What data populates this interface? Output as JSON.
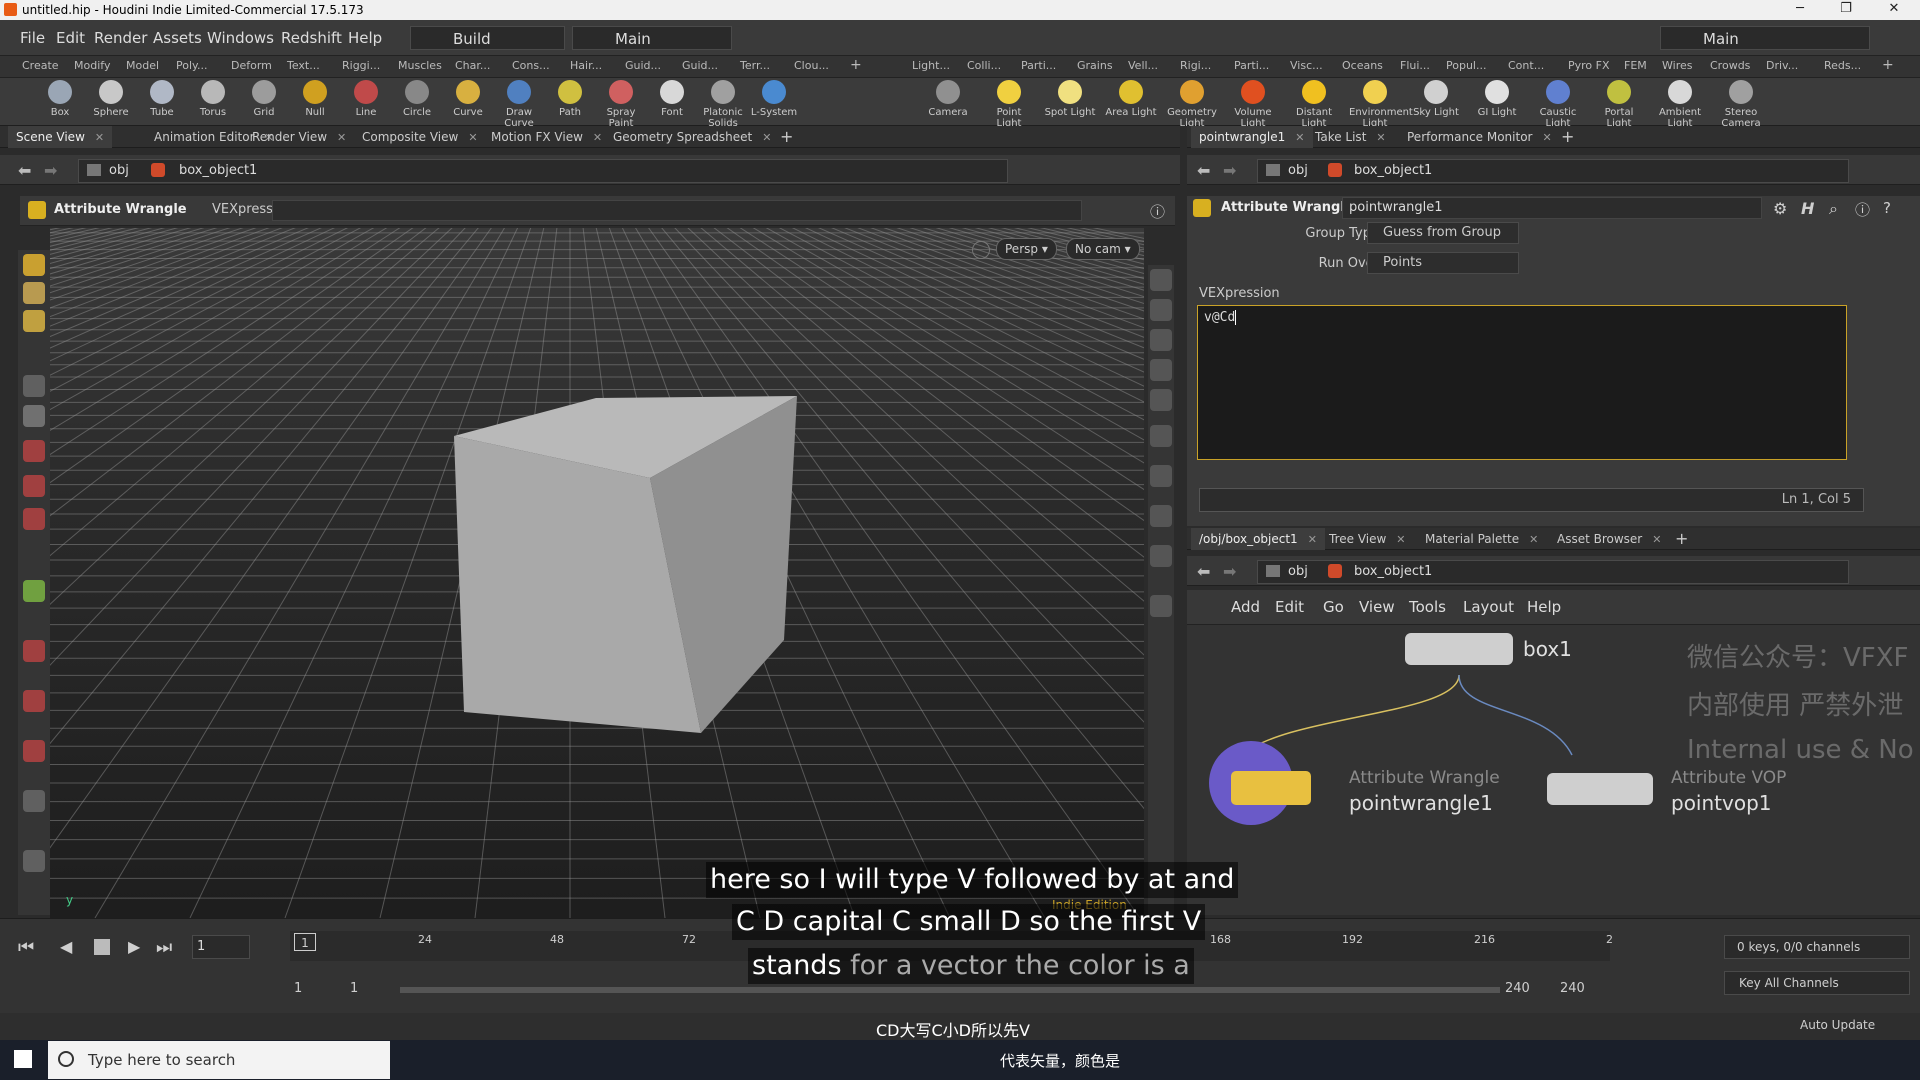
{
  "window": {
    "title": "untitled.hip - Houdini Indie Limited-Commercial 17.5.173"
  },
  "menubar": {
    "items": [
      "File",
      "Edit",
      "Render",
      "Assets",
      "Windows",
      "Redshift",
      "Help"
    ],
    "desktop_left": "Build",
    "desktop_right": "Main",
    "desktop_far_right": "Main"
  },
  "shelf_tabs_left": [
    "Create",
    "Modify",
    "Model",
    "Poly...",
    "Deform",
    "Text...",
    "Riggi...",
    "Muscles",
    "Char...",
    "Cons...",
    "Hair...",
    "Guid...",
    "Guid...",
    "Terr...",
    "Clou..."
  ],
  "shelf_tabs_right": [
    "Light...",
    "Colli...",
    "Parti...",
    "Grains",
    "Vell...",
    "Rigi...",
    "Parti...",
    "Visc...",
    "Oceans",
    "Flui...",
    "Popul...",
    "Cont...",
    "Pyro FX",
    "FEM",
    "Wires",
    "Crowds",
    "Driv...",
    "Reds..."
  ],
  "tools_left": [
    {
      "label": "Box",
      "color": "#9aa6b5"
    },
    {
      "label": "Sphere",
      "color": "#c8c8c8"
    },
    {
      "label": "Tube",
      "color": "#b0b8c6"
    },
    {
      "label": "Torus",
      "color": "#b8b8b8"
    },
    {
      "label": "Grid",
      "color": "#9c9c9c"
    },
    {
      "label": "Null",
      "color": "#d0a020"
    },
    {
      "label": "Line",
      "color": "#c04a4a"
    },
    {
      "label": "Circle",
      "color": "#888888"
    },
    {
      "label": "Curve",
      "color": "#d8b040"
    },
    {
      "label": "Draw Curve",
      "color": "#5080c0"
    },
    {
      "label": "Path",
      "color": "#d0c040"
    },
    {
      "label": "Spray Paint",
      "color": "#d06060"
    },
    {
      "label": "Font",
      "color": "#d8d8d8"
    },
    {
      "label": "Platonic Solids",
      "color": "#a0a0a0"
    },
    {
      "label": "L-System",
      "color": "#4a8ad0"
    }
  ],
  "tools_right": [
    {
      "label": "Camera",
      "color": "#909090"
    },
    {
      "label": "Point Light",
      "color": "#f0d040"
    },
    {
      "label": "Spot Light",
      "color": "#f0e080"
    },
    {
      "label": "Area Light",
      "color": "#e0c030"
    },
    {
      "label": "Geometry Light",
      "color": "#e0a030"
    },
    {
      "label": "Volume Light",
      "color": "#e05020"
    },
    {
      "label": "Distant Light",
      "color": "#f0c020"
    },
    {
      "label": "Environment Light",
      "color": "#f0d050"
    },
    {
      "label": "Sky Light",
      "color": "#d0d0d0"
    },
    {
      "label": "GI Light",
      "color": "#e0e0e0"
    },
    {
      "label": "Caustic Light",
      "color": "#6080d0"
    },
    {
      "label": "Portal Light",
      "color": "#c0c040"
    },
    {
      "label": "Ambient Light",
      "color": "#d8d8d8"
    },
    {
      "label": "Stereo Camera",
      "color": "#a0a0a0"
    }
  ],
  "left_pane": {
    "tabs": [
      "Scene View",
      "Animation Editor",
      "Render View",
      "Composite View",
      "Motion FX View",
      "Geometry Spreadsheet"
    ],
    "path_root": "obj",
    "path_object": "box_object1",
    "operator": "Attribute Wrangle",
    "operator_field": "VEXpression",
    "view_persp": "Persp",
    "view_cam": "No cam",
    "indie_badge": "Indie Edition"
  },
  "parm_pane": {
    "tabs": [
      "pointwrangle1",
      "Take List",
      "Performance Monitor"
    ],
    "path_root": "obj",
    "path_object": "box_object1",
    "node_type": "Attribute Wrangle",
    "node_name": "pointwrangle1",
    "group_type_label": "Group Type",
    "group_type_value": "Guess from Group",
    "run_over_label": "Run Over",
    "run_over_value": "Points",
    "vex_label": "VEXpression",
    "vex_code": "v@Cd",
    "cursor_pos": "Ln 1, Col 5"
  },
  "network_pane": {
    "tabs": [
      "/obj/box_object1",
      "Tree View",
      "Material Palette",
      "Asset Browser"
    ],
    "path_root": "obj",
    "path_object": "box_object1",
    "menu": [
      "Add",
      "Edit",
      "Go",
      "View",
      "Tools",
      "Layout",
      "Help"
    ],
    "nodes": [
      {
        "name": "box1",
        "type": ""
      },
      {
        "name": "pointwrangle1",
        "type": "Attribute Wrangle"
      },
      {
        "name": "pointvop1",
        "type": "Attribute VOP"
      }
    ]
  },
  "timeline": {
    "current_frame": "1",
    "ticks": [
      "1",
      "24",
      "48",
      "72",
      "168",
      "192",
      "216",
      "2"
    ],
    "range_start": "1",
    "range_start2": "1",
    "range_end": "240",
    "range_end2": "240",
    "keys_info": "0 keys, 0/0 channels",
    "key_all": "Key All Channels",
    "auto_update": "Auto Update"
  },
  "subtitles": {
    "line1": "here so I will type V followed by at and",
    "line2": "C D capital C small D so the first V",
    "line3a": "stands",
    "line3b": " for a vector the color is a",
    "cn_line1": "CD大写C小D所以先V",
    "cn_line2": "代表矢量，颜色是"
  },
  "watermarks": {
    "wm1": "微信公众号：VFXF",
    "wm2": "内部使用 严禁外泄",
    "wm3": "Internal use & No s"
  },
  "taskbar": {
    "search_placeholder": "Type here to search"
  }
}
